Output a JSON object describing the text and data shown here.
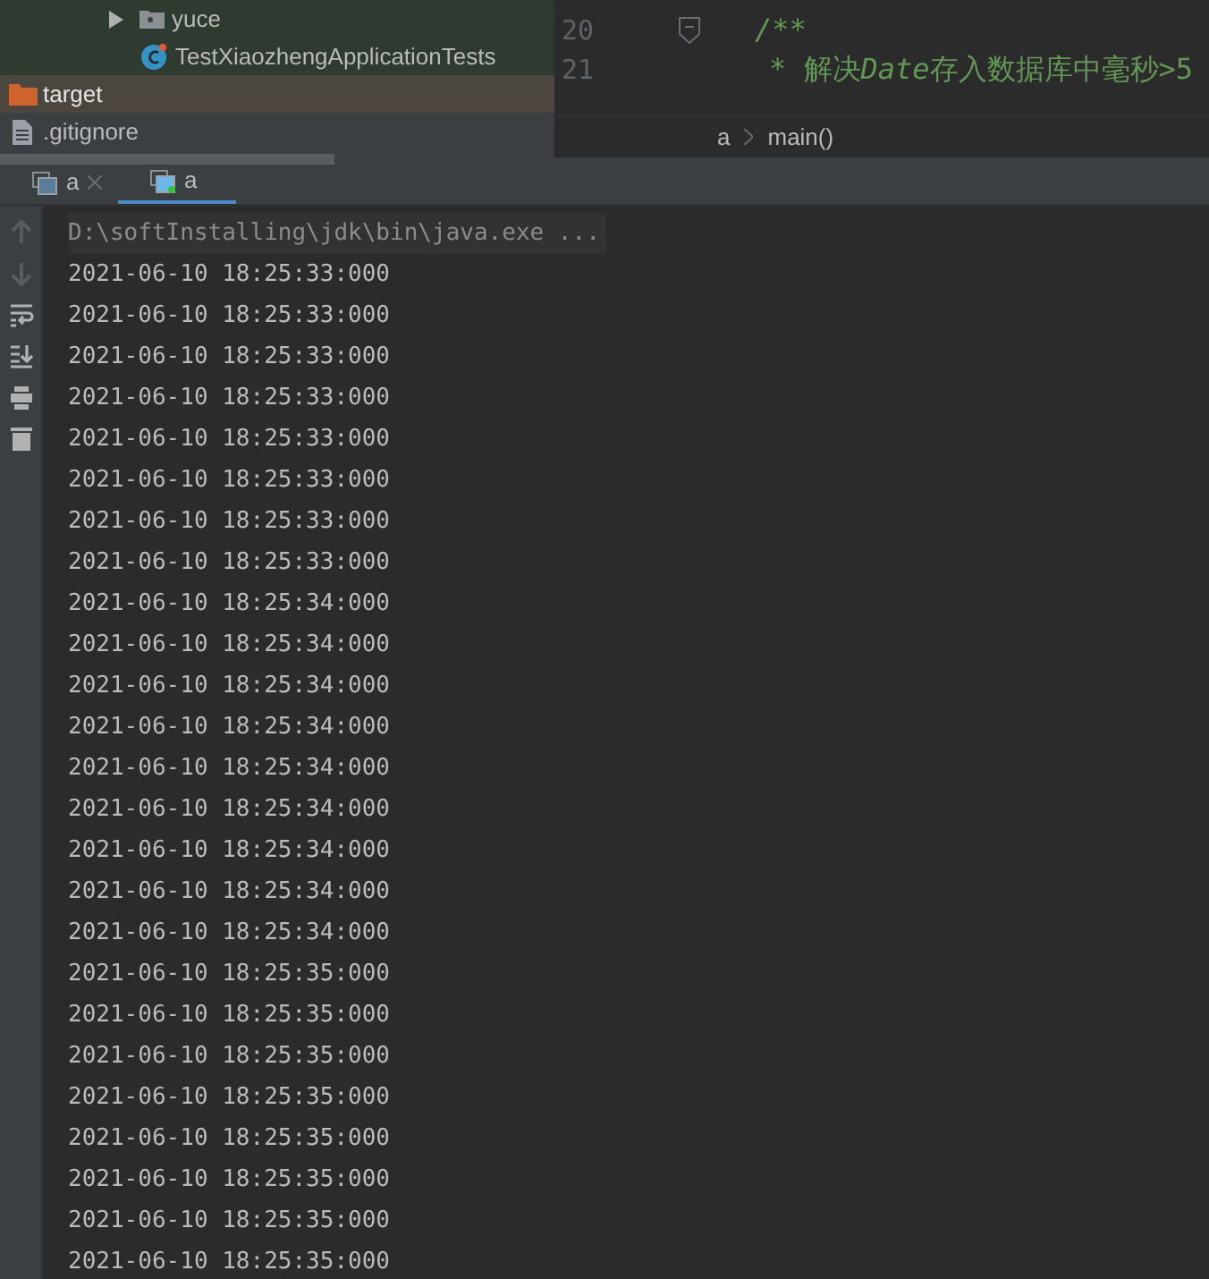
{
  "project_tree": [
    {
      "label": "yuce",
      "kind": "package",
      "selected": false
    },
    {
      "label": "TestXiaozhengApplicationTests",
      "kind": "test-class",
      "selected": false
    },
    {
      "label": "target",
      "kind": "folder",
      "selected": true
    },
    {
      "label": ".gitignore",
      "kind": "file",
      "selected": false
    }
  ],
  "editor": {
    "lines": [
      {
        "number": "20",
        "parts": [
          {
            "text": "/**",
            "italic": true
          }
        ]
      },
      {
        "number": "21",
        "parts": [
          {
            "text": "* 解决",
            "italic": false
          },
          {
            "text": "Date",
            "italic": true
          },
          {
            "text": "存入数据库中毫秒>5",
            "italic": false
          }
        ]
      }
    ],
    "breadcrumbs": [
      "a",
      "main()"
    ]
  },
  "run_tabs": [
    {
      "label": "a",
      "selected": false
    },
    {
      "label": "a",
      "selected": true
    }
  ],
  "console": {
    "command": "D:\\softInstalling\\jdk\\bin\\java.exe ...",
    "output": [
      "2021-06-10 18:25:33:000",
      "2021-06-10 18:25:33:000",
      "2021-06-10 18:25:33:000",
      "2021-06-10 18:25:33:000",
      "2021-06-10 18:25:33:000",
      "2021-06-10 18:25:33:000",
      "2021-06-10 18:25:33:000",
      "2021-06-10 18:25:33:000",
      "2021-06-10 18:25:34:000",
      "2021-06-10 18:25:34:000",
      "2021-06-10 18:25:34:000",
      "2021-06-10 18:25:34:000",
      "2021-06-10 18:25:34:000",
      "2021-06-10 18:25:34:000",
      "2021-06-10 18:25:34:000",
      "2021-06-10 18:25:34:000",
      "2021-06-10 18:25:34:000",
      "2021-06-10 18:25:35:000",
      "2021-06-10 18:25:35:000",
      "2021-06-10 18:25:35:000",
      "2021-06-10 18:25:35:000",
      "2021-06-10 18:25:35:000",
      "2021-06-10 18:25:35:000",
      "2021-06-10 18:25:35:000",
      "2021-06-10 18:25:35:000"
    ]
  }
}
